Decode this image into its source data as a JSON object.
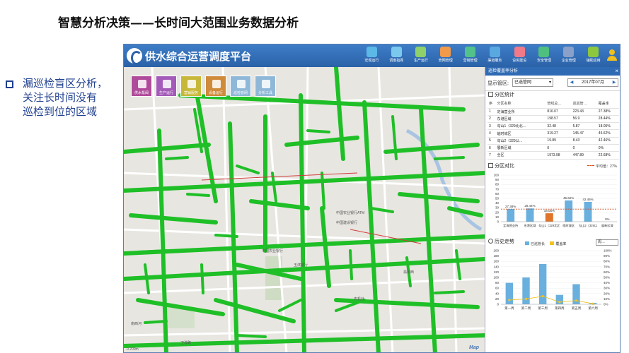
{
  "slide": {
    "title": "智慧分析决策——长时间大范围业务数据分析",
    "bullet_lines": [
      "漏巡检盲区分析，",
      "关注长时间没有",
      "巡检到位的区域"
    ]
  },
  "app": {
    "title": "供水综合运营调度平台",
    "nav": [
      {
        "label": "宏观运行",
        "icon": "dashboard-icon",
        "color": "#5cb8e6"
      },
      {
        "label": "调度指挥",
        "icon": "command-icon",
        "color": "#7bc8ef"
      },
      {
        "label": "生产运行",
        "icon": "production-icon",
        "color": "#8ed06a"
      },
      {
        "label": "管网管理",
        "icon": "pipe-network-icon",
        "color": "#f19a4a"
      },
      {
        "label": "营销管理",
        "icon": "marketing-icon",
        "color": "#53c28a"
      },
      {
        "label": "渠道服务",
        "icon": "channel-icon",
        "color": "#5aa8e0"
      },
      {
        "label": "设资建设",
        "icon": "construction-icon",
        "color": "#f07a8a"
      },
      {
        "label": "安全管理",
        "icon": "safety-icon",
        "color": "#4fbf7f"
      },
      {
        "label": "企业管理",
        "icon": "enterprise-icon",
        "color": "#8aa0c8"
      },
      {
        "label": "辅助应用",
        "icon": "gear-icon",
        "color": "#8dc63f"
      }
    ]
  },
  "map_tools": [
    {
      "label": "供水泵阀",
      "color": "#b04a9a",
      "icon": "valve-icon"
    },
    {
      "label": "生产运行",
      "color": "#a45ab8",
      "icon": "production-icon"
    },
    {
      "label": "营销服务",
      "color": "#c8b83a",
      "icon": "service-icon"
    },
    {
      "label": "设备运行",
      "color": "#cf8a3a",
      "icon": "equipment-icon"
    },
    {
      "label": "巡检管网",
      "color": "#8fb8d8",
      "icon": "inspection-icon"
    },
    {
      "label": "分析工具",
      "color": "#8fb8d8",
      "icon": "analysis-icon"
    }
  ],
  "map": {
    "brand": "Map",
    "scale_text": "0  200m",
    "labels": [
      {
        "text": "中国农业银行ATM"
      },
      {
        "text": "中国建设银行"
      },
      {
        "text": "中国农业银行"
      },
      {
        "text": "玉滨银行"
      },
      {
        "text": "卫浅路"
      },
      {
        "text": "南西河"
      },
      {
        "text": "农机处"
      },
      {
        "text": "翡翠西"
      }
    ]
  },
  "panel": {
    "title": "巡检覆盖率分析",
    "filter_label": "显示管区:",
    "filter_value": "已选管网",
    "date_value": "2017年07月",
    "stats_section": "分区统计",
    "stats_headers": [
      "序",
      "分区名称",
      "管线总…",
      "巡巡管…",
      "覆盖率"
    ],
    "stats_rows": [
      [
        "1",
        "定海营业所",
        "816.07",
        "223.43",
        "27.38%"
      ],
      [
        "2",
        "东港区域",
        "198.57",
        "56.9",
        "28.44%"
      ],
      [
        "3",
        "勾山1（329北北…",
        "32.48",
        "5.87",
        "18.05%"
      ],
      [
        "4",
        "临时城区",
        "319.27",
        "145.47",
        "45.62%"
      ],
      [
        "5",
        "勾山2（329以…",
        "19.89",
        "8.43",
        "42.46%"
      ],
      [
        "6",
        "展新区域",
        "0",
        "0",
        "0%"
      ],
      [
        "7",
        "全区",
        "1973.98",
        "447.89",
        "22.68%"
      ]
    ],
    "compare_section": "分区对比",
    "avg_legend": "平均值：27%",
    "trend_section": "历史走势",
    "trend_legend": [
      "已巡管长",
      "覆盖率"
    ],
    "trend_select": "周…"
  },
  "chart_data": [
    {
      "type": "bar",
      "title": "分区对比",
      "categories": [
        "定海营业所",
        "东港区域",
        "勾山1（329北北",
        "临时城区",
        "勾山2（329以",
        "展新区域"
      ],
      "values": [
        27.38,
        28.44,
        18.05,
        45.62,
        42.46,
        0
      ],
      "data_labels": [
        "27.38%",
        "28.44%",
        "18.05%",
        "45.62%",
        "42.46%",
        "0%"
      ],
      "yticks": [
        "100",
        "90",
        "80",
        "70",
        "60",
        "50",
        "40",
        "30",
        "20",
        "10",
        "0"
      ],
      "ylim": [
        0,
        100
      ],
      "average": 27,
      "colors": [
        "#6ab0de",
        "#6ab0de",
        "#e0742a",
        "#6ab0de",
        "#6ab0de",
        "#6ab0de"
      ]
    },
    {
      "type": "bar",
      "title": "历史走势",
      "categories": [
        "第一周",
        "第二周",
        "第三周",
        "第四周",
        "第五周",
        "第六周"
      ],
      "series": [
        {
          "name": "已巡管长",
          "values": [
            80,
            100,
            150,
            35,
            75,
            5
          ]
        },
        {
          "name": "覆盖率",
          "values": [
            8,
            10,
            15,
            4,
            7,
            1
          ]
        }
      ],
      "yticks_left": [
        "200",
        "180",
        "160",
        "140",
        "120",
        "100",
        "80",
        "60",
        "40",
        "20",
        "0"
      ],
      "yticks_right": [
        "100%",
        "90%",
        "80%",
        "70%",
        "60%",
        "50%",
        "40%",
        "30%",
        "20%",
        "10%",
        "0%"
      ],
      "ylim": [
        0,
        200
      ],
      "y2lim": [
        0,
        100
      ],
      "colors": [
        "#6ab0de",
        "#f2c320"
      ]
    }
  ]
}
